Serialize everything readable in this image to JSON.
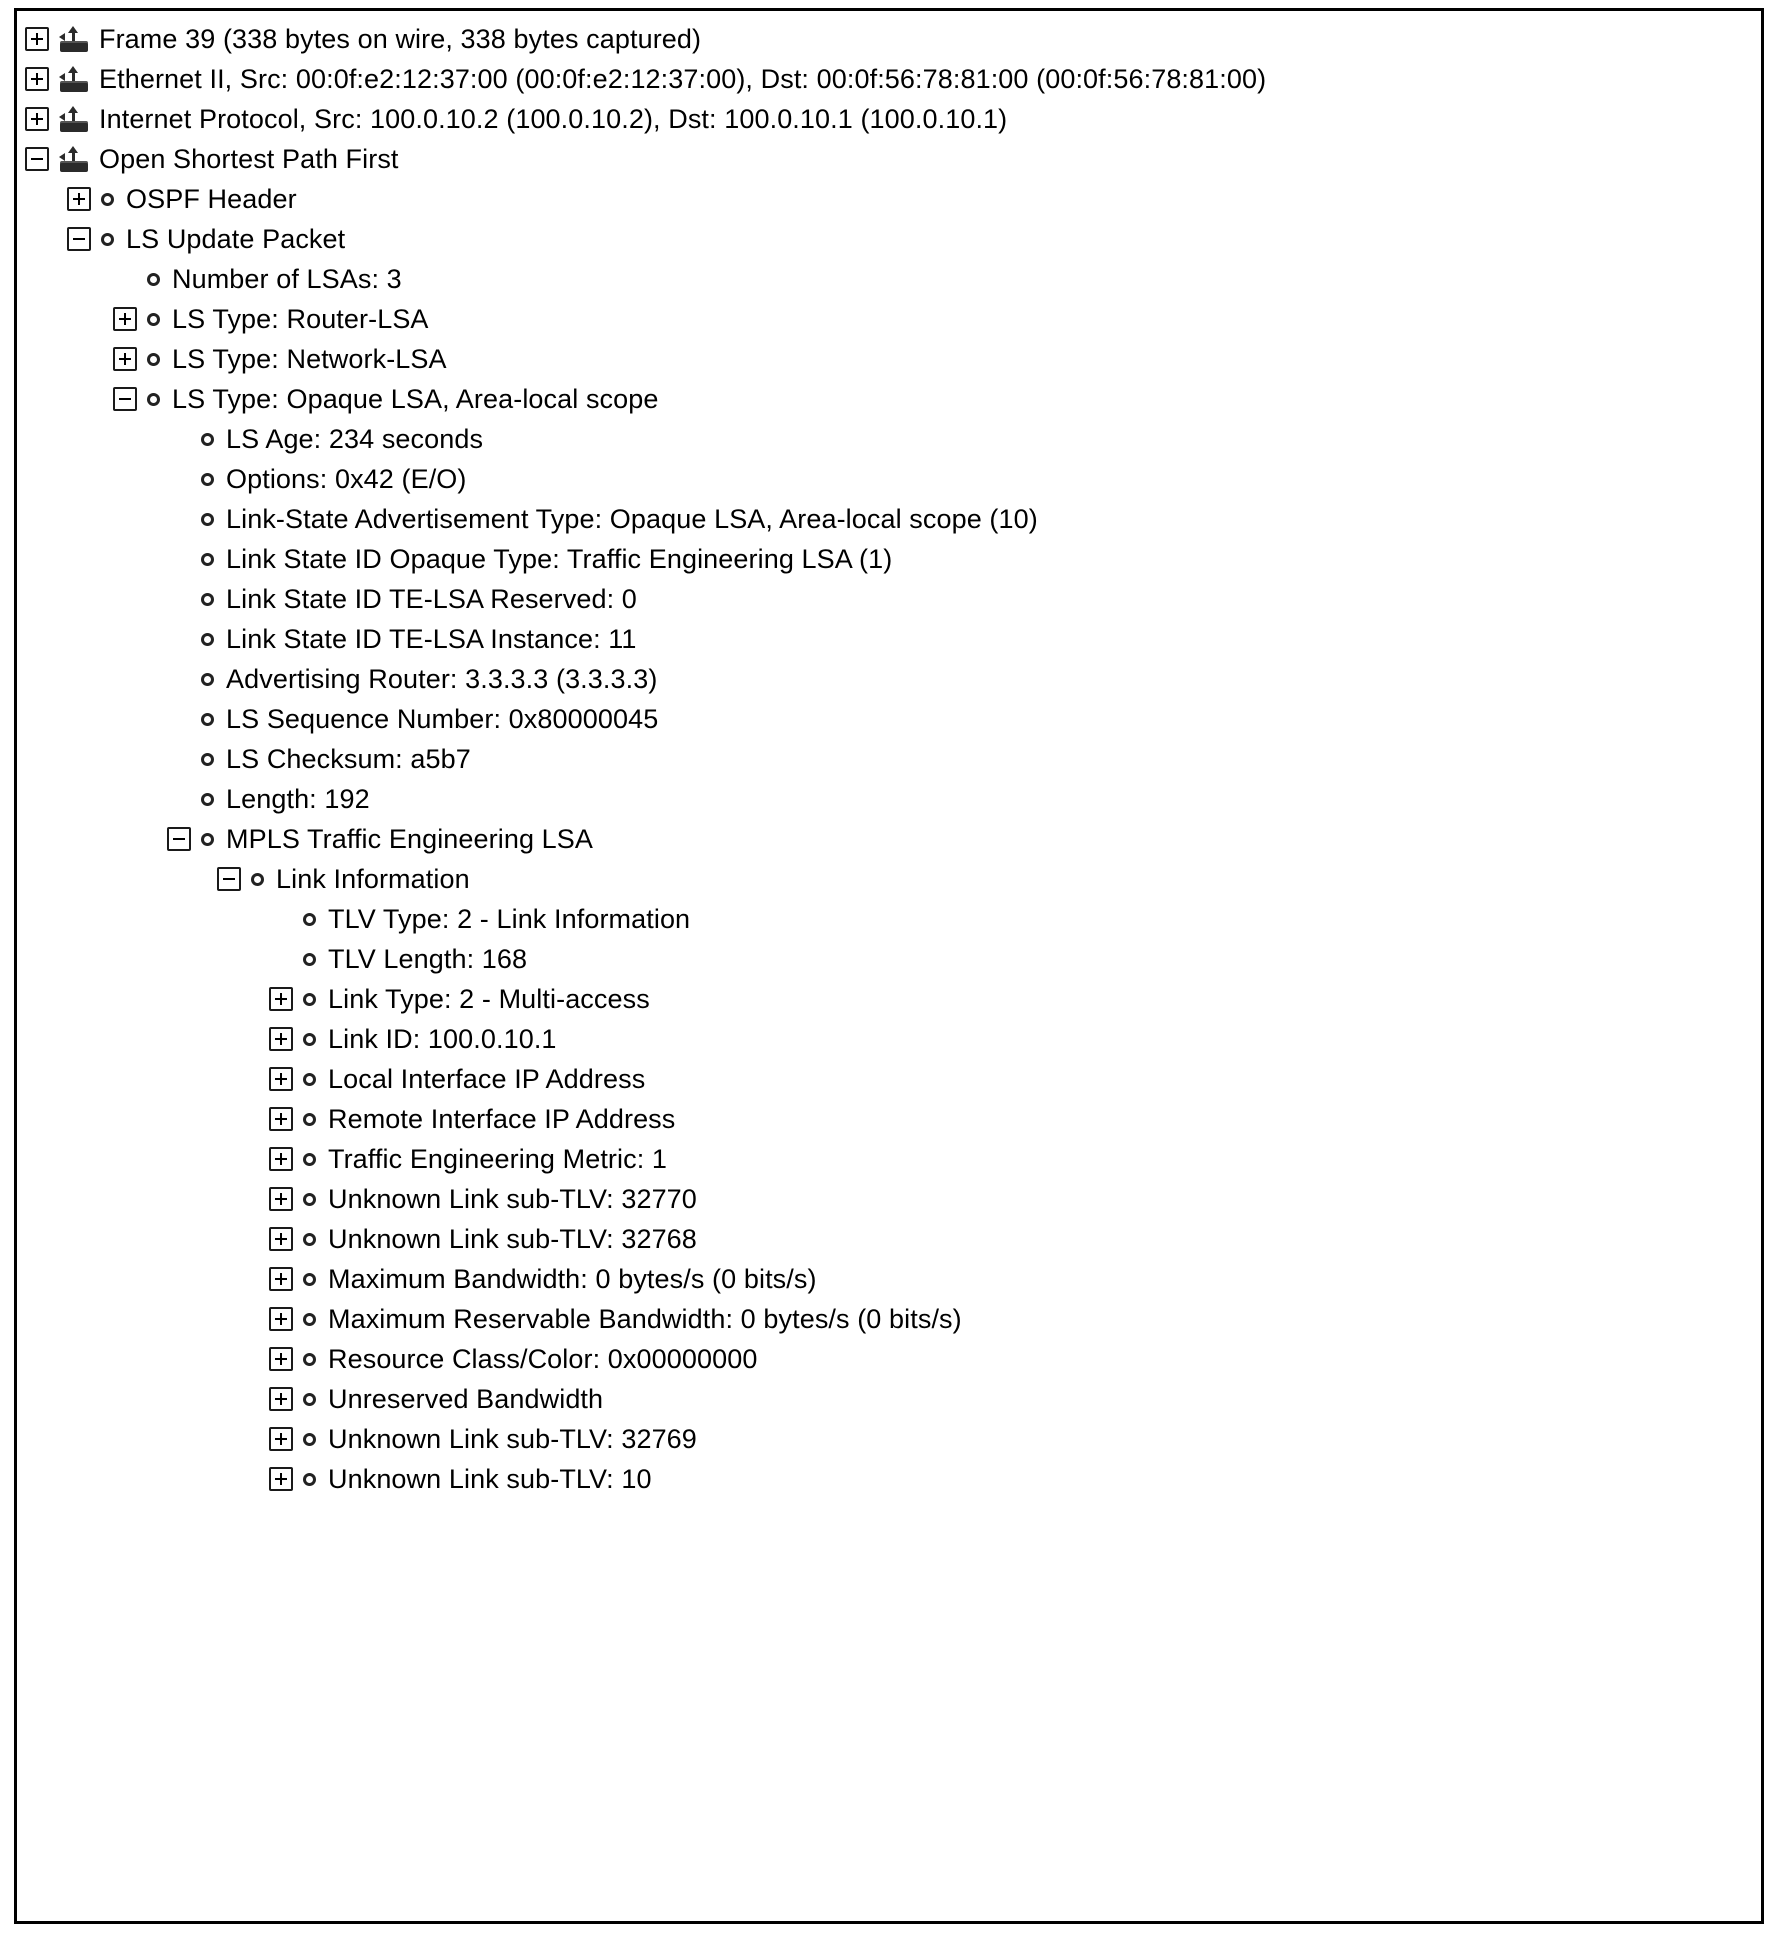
{
  "panel": {
    "name": "packet-details-tree",
    "background_color": "#ffffff",
    "border_color": "#000000",
    "text_color": "#000000"
  },
  "tree": {
    "rows": [
      {
        "label": "Frame 39 (338 bytes on wire, 338 bytes captured)",
        "depth": 0,
        "toggle": "plus",
        "icon": "router-icon",
        "name": "tree-row-frame"
      },
      {
        "label": "Ethernet II, Src: 00:0f:e2:12:37:00 (00:0f:e2:12:37:00), Dst: 00:0f:56:78:81:00 (00:0f:56:78:81:00)",
        "depth": 0,
        "toggle": "plus",
        "icon": "router-icon",
        "name": "tree-row-ethernet"
      },
      {
        "label": "Internet Protocol, Src: 100.0.10.2 (100.0.10.2), Dst: 100.0.10.1 (100.0.10.1)",
        "depth": 0,
        "toggle": "plus",
        "icon": "router-icon",
        "name": "tree-row-internet-protocol"
      },
      {
        "label": "Open Shortest Path First",
        "depth": 0,
        "toggle": "minus",
        "icon": "router-icon",
        "name": "tree-row-ospf"
      },
      {
        "label": "OSPF Header",
        "depth": 1,
        "toggle": "plus",
        "icon": "field-icon",
        "name": "tree-row-ospf-header"
      },
      {
        "label": "LS Update Packet",
        "depth": 1,
        "toggle": "minus",
        "icon": "field-icon",
        "name": "tree-row-ls-update-packet"
      },
      {
        "label": "Number of LSAs: 3",
        "depth": 2,
        "toggle": "none",
        "icon": "field-icon",
        "name": "tree-row-number-of-lsas"
      },
      {
        "label": "LS Type: Router-LSA",
        "depth": 2,
        "toggle": "plus",
        "icon": "field-icon",
        "name": "tree-row-ls-type-router-lsa"
      },
      {
        "label": "LS Type: Network-LSA",
        "depth": 2,
        "toggle": "plus",
        "icon": "field-icon",
        "name": "tree-row-ls-type-network-lsa"
      },
      {
        "label": "LS Type: Opaque LSA, Area-local scope",
        "depth": 2,
        "toggle": "minus",
        "icon": "field-icon",
        "name": "tree-row-ls-type-opaque-lsa"
      },
      {
        "label": "LS Age: 234 seconds",
        "depth": 3,
        "toggle": "none",
        "icon": "field-icon",
        "name": "tree-row-ls-age"
      },
      {
        "label": "Options: 0x42 (E/O)",
        "depth": 3,
        "toggle": "none",
        "icon": "field-icon",
        "name": "tree-row-options"
      },
      {
        "label": "Link-State Advertisement Type: Opaque LSA, Area-local scope (10)",
        "depth": 3,
        "toggle": "none",
        "icon": "field-icon",
        "name": "tree-row-link-state-advertisement-type"
      },
      {
        "label": "Link State ID Opaque Type: Traffic Engineering LSA (1)",
        "depth": 3,
        "toggle": "none",
        "icon": "field-icon",
        "name": "tree-row-link-state-id-opaque-type"
      },
      {
        "label": "Link State ID TE-LSA Reserved: 0",
        "depth": 3,
        "toggle": "none",
        "icon": "field-icon",
        "name": "tree-row-link-state-id-te-lsa-reserved"
      },
      {
        "label": "Link State ID TE-LSA Instance: 11",
        "depth": 3,
        "toggle": "none",
        "icon": "field-icon",
        "name": "tree-row-link-state-id-te-lsa-instance"
      },
      {
        "label": "Advertising Router: 3.3.3.3 (3.3.3.3)",
        "depth": 3,
        "toggle": "none",
        "icon": "field-icon",
        "name": "tree-row-advertising-router"
      },
      {
        "label": "LS Sequence Number: 0x80000045",
        "depth": 3,
        "toggle": "none",
        "icon": "field-icon",
        "name": "tree-row-ls-sequence-number"
      },
      {
        "label": "LS Checksum: a5b7",
        "depth": 3,
        "toggle": "none",
        "icon": "field-icon",
        "name": "tree-row-ls-checksum"
      },
      {
        "label": "Length: 192",
        "depth": 3,
        "toggle": "none",
        "icon": "field-icon",
        "name": "tree-row-length"
      },
      {
        "label": "MPLS Traffic Engineering LSA",
        "depth": 3,
        "toggle": "minus",
        "icon": "field-icon",
        "name": "tree-row-mpls-traffic-engineering-lsa"
      },
      {
        "label": "Link Information",
        "depth": 4,
        "toggle": "minus",
        "icon": "field-icon",
        "name": "tree-row-link-information"
      },
      {
        "label": "TLV Type: 2 - Link Information",
        "depth": 5,
        "toggle": "none",
        "icon": "field-icon",
        "name": "tree-row-tlv-type"
      },
      {
        "label": "TLV Length: 168",
        "depth": 5,
        "toggle": "none",
        "icon": "field-icon",
        "name": "tree-row-tlv-length"
      },
      {
        "label": "Link Type: 2 - Multi-access",
        "depth": 5,
        "toggle": "plus",
        "icon": "field-icon",
        "name": "tree-row-link-type"
      },
      {
        "label": "Link ID: 100.0.10.1",
        "depth": 5,
        "toggle": "plus",
        "icon": "field-icon",
        "name": "tree-row-link-id"
      },
      {
        "label": "Local Interface IP Address",
        "depth": 5,
        "toggle": "plus",
        "icon": "field-icon",
        "name": "tree-row-local-interface-ip-address"
      },
      {
        "label": "Remote Interface IP Address",
        "depth": 5,
        "toggle": "plus",
        "icon": "field-icon",
        "name": "tree-row-remote-interface-ip-address"
      },
      {
        "label": "Traffic Engineering Metric: 1",
        "depth": 5,
        "toggle": "plus",
        "icon": "field-icon",
        "name": "tree-row-traffic-engineering-metric"
      },
      {
        "label": "Unknown Link sub-TLV: 32770",
        "depth": 5,
        "toggle": "plus",
        "icon": "field-icon",
        "name": "tree-row-unknown-link-sub-tlv-32770"
      },
      {
        "label": "Unknown Link sub-TLV: 32768",
        "depth": 5,
        "toggle": "plus",
        "icon": "field-icon",
        "name": "tree-row-unknown-link-sub-tlv-32768"
      },
      {
        "label": "Maximum Bandwidth: 0 bytes/s (0 bits/s)",
        "depth": 5,
        "toggle": "plus",
        "icon": "field-icon",
        "name": "tree-row-maximum-bandwidth"
      },
      {
        "label": "Maximum Reservable Bandwidth: 0 bytes/s (0 bits/s)",
        "depth": 5,
        "toggle": "plus",
        "icon": "field-icon",
        "name": "tree-row-maximum-reservable-bandwidth"
      },
      {
        "label": "Resource Class/Color: 0x00000000",
        "depth": 5,
        "toggle": "plus",
        "icon": "field-icon",
        "name": "tree-row-resource-class-color"
      },
      {
        "label": "Unreserved Bandwidth",
        "depth": 5,
        "toggle": "plus",
        "icon": "field-icon",
        "name": "tree-row-unreserved-bandwidth"
      },
      {
        "label": "Unknown Link sub-TLV: 32769",
        "depth": 5,
        "toggle": "plus",
        "icon": "field-icon",
        "name": "tree-row-unknown-link-sub-tlv-32769"
      },
      {
        "label": "Unknown Link sub-TLV: 10",
        "depth": 5,
        "toggle": "plus",
        "icon": "field-icon",
        "name": "tree-row-unknown-link-sub-tlv-10"
      }
    ]
  }
}
